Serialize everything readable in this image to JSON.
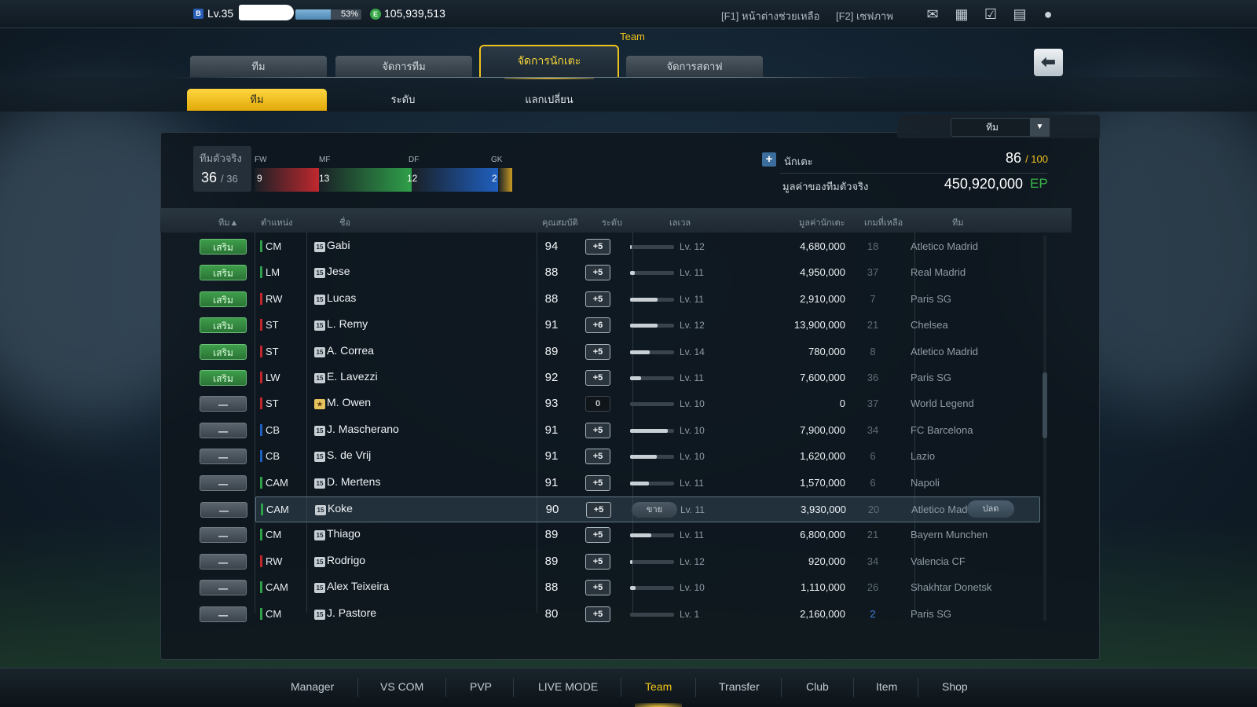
{
  "topbar": {
    "level_badge": "B",
    "level": "Lv.35",
    "xp_percent": 53,
    "xp_label": "53%",
    "coin_icon": "E",
    "coins": "105,939,513",
    "help_f1": "[F1] หน้าต่างช่วยเหลือ",
    "help_f2": "[F2] เซฟภาพ",
    "icons": [
      "mail-icon",
      "roster-icon",
      "calendar-check-icon",
      "chat-icon",
      "profile-icon"
    ]
  },
  "section_title": "Team",
  "tabs": [
    {
      "label": "ทีม"
    },
    {
      "label": "จัดการทีม"
    },
    {
      "label": "จัดการนักเตะ"
    },
    {
      "label": "จัดการสตาฟ"
    }
  ],
  "back_icon": "back-arrow-icon",
  "subtabs": [
    {
      "label": "ทีม"
    },
    {
      "label": "ระดับ"
    },
    {
      "label": "แลกเปลี่ยน"
    }
  ],
  "filter": {
    "value": "ทีม"
  },
  "squad": {
    "label": "ทีมตัวจริง",
    "current": "36",
    "max": "/ 36",
    "positions": [
      {
        "label": "FW",
        "count": "9",
        "color": "#c0282e"
      },
      {
        "label": "MF",
        "count": "13",
        "color": "#2fa04a"
      },
      {
        "label": "DF",
        "count": "12",
        "color": "#1f5fbf"
      },
      {
        "label": "GK",
        "count": "2",
        "color": "#c79a22"
      }
    ]
  },
  "summary": {
    "players_label": "นักเตะ",
    "players_count": "86",
    "players_max": "/ 100",
    "value_label": "มูลค่าของทีมตัวจริง",
    "value": "450,920,000",
    "value_unit": "EP"
  },
  "table": {
    "headers": {
      "team": "ทีม▲",
      "position": "ตำแหน่ง",
      "name": "ชื่อ",
      "ovr": "คุณสมบัติ",
      "grade": "ระดับ",
      "level": "เลเวล",
      "value": "มูลค่านักเตะ",
      "games": "เกมที่เหลือ",
      "club": "ทีม"
    },
    "sell_label": "ขาย",
    "release_label": "ปลด",
    "rows": [
      {
        "status": "เสริม",
        "active": true,
        "pos": "CM",
        "pos_color": "#2fa04a",
        "card": "15",
        "name": "Gabi",
        "ovr": "94",
        "grade": "+5",
        "level_fill": 0.03,
        "lv": "Lv. 12",
        "value": "4,680,000",
        "games": "18",
        "club": "Atletico Madrid"
      },
      {
        "status": "เสริม",
        "active": true,
        "pos": "LM",
        "pos_color": "#2fa04a",
        "card": "15",
        "name": "Jese",
        "ovr": "88",
        "grade": "+5",
        "level_fill": 0.1,
        "lv": "Lv. 11",
        "value": "4,950,000",
        "games": "37",
        "club": "Real Madrid"
      },
      {
        "status": "เสริม",
        "active": true,
        "pos": "RW",
        "pos_color": "#c0282e",
        "card": "15",
        "name": "Lucas",
        "ovr": "88",
        "grade": "+5",
        "level_fill": 0.62,
        "lv": "Lv. 11",
        "value": "2,910,000",
        "games": "7",
        "club": "Paris SG"
      },
      {
        "status": "เสริม",
        "active": true,
        "pos": "ST",
        "pos_color": "#c0282e",
        "card": "15",
        "name": "L. Remy",
        "ovr": "91",
        "grade": "+6",
        "level_fill": 0.62,
        "lv": "Lv. 12",
        "value": "13,900,000",
        "games": "21",
        "club": "Chelsea"
      },
      {
        "status": "เสริม",
        "active": true,
        "pos": "ST",
        "pos_color": "#c0282e",
        "card": "15",
        "name": "A. Correa",
        "ovr": "89",
        "grade": "+5",
        "level_fill": 0.45,
        "lv": "Lv. 14",
        "value": "780,000",
        "games": "8",
        "club": "Atletico Madrid"
      },
      {
        "status": "เสริม",
        "active": true,
        "pos": "LW",
        "pos_color": "#c0282e",
        "card": "15",
        "name": "E. Lavezzi",
        "ovr": "92",
        "grade": "+5",
        "level_fill": 0.25,
        "lv": "Lv. 11",
        "value": "7,600,000",
        "games": "36",
        "club": "Paris SG"
      },
      {
        "status": "—",
        "active": false,
        "pos": "ST",
        "pos_color": "#c0282e",
        "card": "★",
        "legend": true,
        "name": "M. Owen",
        "ovr": "93",
        "grade": "0",
        "grade_zero": true,
        "level_fill": 0,
        "lv": "Lv. 10",
        "value": "0",
        "games": "37",
        "club": "World Legend"
      },
      {
        "status": "—",
        "active": false,
        "pos": "CB",
        "pos_color": "#1f5fbf",
        "card": "15",
        "name": "J. Mascherano",
        "ovr": "91",
        "grade": "+5",
        "level_fill": 0.85,
        "lv": "Lv. 10",
        "value": "7,900,000",
        "games": "34",
        "club": "FC Barcelona"
      },
      {
        "status": "—",
        "active": false,
        "pos": "CB",
        "pos_color": "#1f5fbf",
        "card": "15",
        "name": "S. de Vrij",
        "ovr": "91",
        "grade": "+5",
        "level_fill": 0.6,
        "lv": "Lv. 10",
        "value": "1,620,000",
        "games": "6",
        "club": "Lazio"
      },
      {
        "status": "—",
        "active": false,
        "pos": "CAM",
        "pos_color": "#2fa04a",
        "card": "15",
        "name": "D. Mertens",
        "ovr": "91",
        "grade": "+5",
        "level_fill": 0.42,
        "lv": "Lv. 11",
        "value": "1,570,000",
        "games": "6",
        "club": "Napoli"
      },
      {
        "status": "—",
        "active": false,
        "selected": true,
        "pos": "CAM",
        "pos_color": "#2fa04a",
        "card": "15",
        "name": "Koke",
        "ovr": "90",
        "grade": "+5",
        "level_fill": 0,
        "lv": "Lv. 11",
        "value": "3,930,000",
        "games": "20",
        "club": "Atletico Madi"
      },
      {
        "status": "—",
        "active": false,
        "pos": "CM",
        "pos_color": "#2fa04a",
        "card": "15",
        "name": "Thiago",
        "ovr": "89",
        "grade": "+5",
        "level_fill": 0.48,
        "lv": "Lv. 11",
        "value": "6,800,000",
        "games": "21",
        "club": "Bayern Munchen"
      },
      {
        "status": "—",
        "active": false,
        "pos": "RW",
        "pos_color": "#c0282e",
        "card": "15",
        "name": "Rodrigo",
        "ovr": "89",
        "grade": "+5",
        "level_fill": 0.05,
        "lv": "Lv. 12",
        "value": "920,000",
        "games": "34",
        "club": "Valencia CF"
      },
      {
        "status": "—",
        "active": false,
        "pos": "CAM",
        "pos_color": "#2fa04a",
        "card": "15",
        "name": "Alex Teixeira",
        "ovr": "88",
        "grade": "+5",
        "level_fill": 0.12,
        "lv": "Lv. 10",
        "value": "1,110,000",
        "games": "26",
        "club": "Shakhtar Donetsk"
      },
      {
        "status": "—",
        "active": false,
        "pos": "CM",
        "pos_color": "#2fa04a",
        "card": "15",
        "name": "J. Pastore",
        "ovr": "80",
        "grade": "+5",
        "level_fill": 0,
        "lv": "Lv. 1",
        "value": "2,160,000",
        "games": "2",
        "games_low": true,
        "club": "Paris SG"
      }
    ]
  },
  "bottom_nav": [
    {
      "label": "Manager"
    },
    {
      "label": "VS COM"
    },
    {
      "label": "PVP"
    },
    {
      "label": "LIVE MODE"
    },
    {
      "label": "Team",
      "active": true
    },
    {
      "label": "Transfer"
    },
    {
      "label": "Club"
    },
    {
      "label": "Item"
    },
    {
      "label": "Shop"
    }
  ]
}
